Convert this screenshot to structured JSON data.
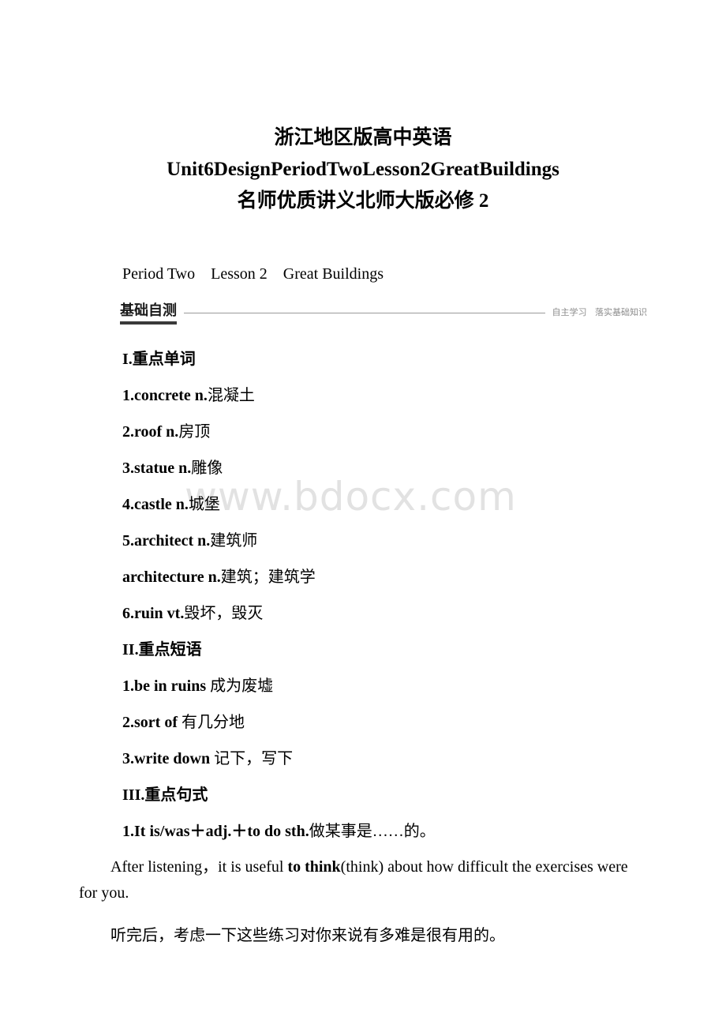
{
  "watermark": "www.bdocx.com",
  "doc_title": {
    "line1": "浙江地区版高中英语",
    "line2": "Unit6DesignPeriodTwoLesson2GreatBuildings",
    "line3": "名师优质讲义北师大版必修 2"
  },
  "period_line": "Period Two    Lesson 2    Great Buildings",
  "band": {
    "badge": "基础自测",
    "tags": "自主学习   落实基础知识"
  },
  "sections": {
    "words_heading": "I.重点单词",
    "words": [
      {
        "term": "1.concrete n.",
        "gloss": "混凝土"
      },
      {
        "term": "2.roof n.",
        "gloss": "房顶"
      },
      {
        "term": "3.statue n.",
        "gloss": "雕像"
      },
      {
        "term": "4.castle n.",
        "gloss": "城堡"
      },
      {
        "term": "5.architect n.",
        "gloss": "建筑师"
      },
      {
        "term": "architecture n.",
        "gloss": "建筑；建筑学"
      },
      {
        "term": "6.ruin vt.",
        "gloss": "毁坏，毁灭"
      }
    ],
    "phrases_heading": "II.重点短语",
    "phrases": [
      {
        "term": "1.be in ruins ",
        "gloss": "成为废墟"
      },
      {
        "term": "2.sort of ",
        "gloss": "有几分地"
      },
      {
        "term": "3.write down ",
        "gloss": "记下，写下"
      }
    ],
    "patterns_heading": "III.重点句式",
    "pattern_1": {
      "term": "1.It is/was＋adj.＋to do sth.",
      "gloss": "做某事是……的。"
    },
    "example_en_bold": "to think",
    "example_en_pre": "After listening，it is useful ",
    "example_en_post": "(think) about how difficult the exercises were for you.",
    "example_cn": "听完后，考虑一下这些练习对你来说有多难是很有用的。"
  }
}
